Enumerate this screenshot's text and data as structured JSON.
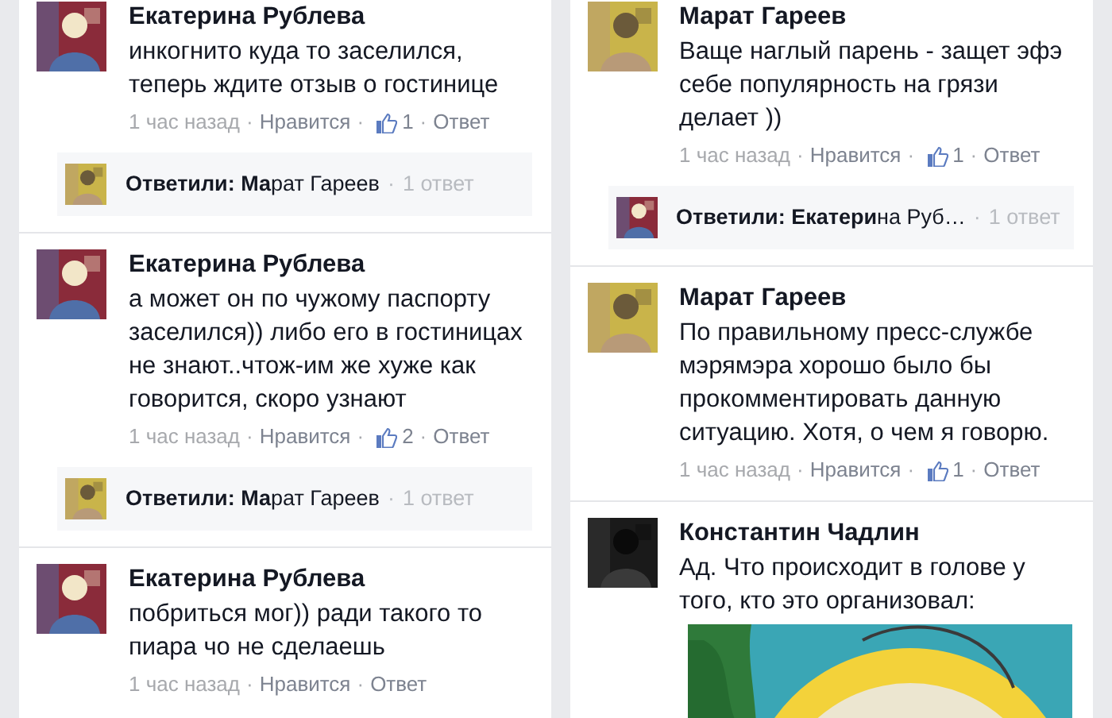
{
  "columns": [
    {
      "comments": [
        {
          "author": "Екатерина Рублева",
          "text": "инкогнито куда то заселился, теперь ждите отзыв о гостинице",
          "meta": [
            {
              "kind": "time",
              "text": "1 час назад"
            },
            {
              "kind": "sep",
              "text": "·"
            },
            {
              "kind": "link",
              "text": "Нравится"
            },
            {
              "kind": "sep",
              "text": "·"
            },
            {
              "kind": "likes",
              "text": "1"
            },
            {
              "kind": "sep",
              "text": "·"
            },
            {
              "kind": "link",
              "text": "Ответ"
            }
          ],
          "replies": {
            "label": "**Ответили: Ма**рат Гареев",
            "sep": "·",
            "count": "1 ответ"
          }
        },
        {
          "author": "Екатерина Рублева",
          "text": "а может он по чужому паспорту заселился)) либо его в гостиницах не знают..чтож-им же хуже как говорится, скоро узнают",
          "meta": [
            {
              "kind": "time",
              "text": "1 час назад"
            },
            {
              "kind": "sep",
              "text": "·"
            },
            {
              "kind": "link",
              "text": "Нравится"
            },
            {
              "kind": "sep",
              "text": "·"
            },
            {
              "kind": "likes",
              "text": "2"
            },
            {
              "kind": "sep",
              "text": "·"
            },
            {
              "kind": "link",
              "text": "Ответ"
            }
          ],
          "replies": {
            "label": "**Ответили: Ма**рат Гареев",
            "sep": "·",
            "count": "1 ответ"
          }
        },
        {
          "author": "Екатерина Рублева",
          "text": "побриться мог)) ради такого то пиара чо не сделаешь",
          "meta": [
            {
              "kind": "time",
              "text": "1 час назад"
            },
            {
              "kind": "sep",
              "text": "·"
            },
            {
              "kind": "link",
              "text": "Нравится"
            },
            {
              "kind": "sep",
              "text": "·"
            },
            {
              "kind": "link",
              "text": "Ответ"
            }
          ]
        }
      ]
    },
    {
      "comments": [
        {
          "author": "Марат Гареев",
          "text": "Ваще наглый парень - защет эфэ себе популярность на грязи делает ))",
          "meta": [
            {
              "kind": "time",
              "text": "1 час назад"
            },
            {
              "kind": "sep",
              "text": "·"
            },
            {
              "kind": "link",
              "text": "Нравится"
            },
            {
              "kind": "sep",
              "text": "·"
            },
            {
              "kind": "likes",
              "text": "1"
            },
            {
              "kind": "sep",
              "text": "·"
            },
            {
              "kind": "link",
              "text": "Ответ"
            }
          ],
          "replies": {
            "label": "**Ответили: Екатери**на Руб…",
            "sep": "·",
            "count": "1 ответ"
          }
        },
        {
          "author": "Марат Гареев",
          "text": "По правильному пресс-службе мэрямэра хорошо было бы прокомментировать данную ситуацию. Хотя, о чем я говорю.",
          "meta": [
            {
              "kind": "time",
              "text": "1 час назад"
            },
            {
              "kind": "sep",
              "text": "·"
            },
            {
              "kind": "link",
              "text": "Нравится"
            },
            {
              "kind": "sep",
              "text": "·"
            },
            {
              "kind": "likes",
              "text": "1"
            },
            {
              "kind": "sep",
              "text": "·"
            },
            {
              "kind": "link",
              "text": "Ответ"
            }
          ]
        },
        {
          "author": "Константин Чадлин",
          "text": "Ад. Что происходит в голове у того, кто это организовал:"
        }
      ]
    }
  ]
}
